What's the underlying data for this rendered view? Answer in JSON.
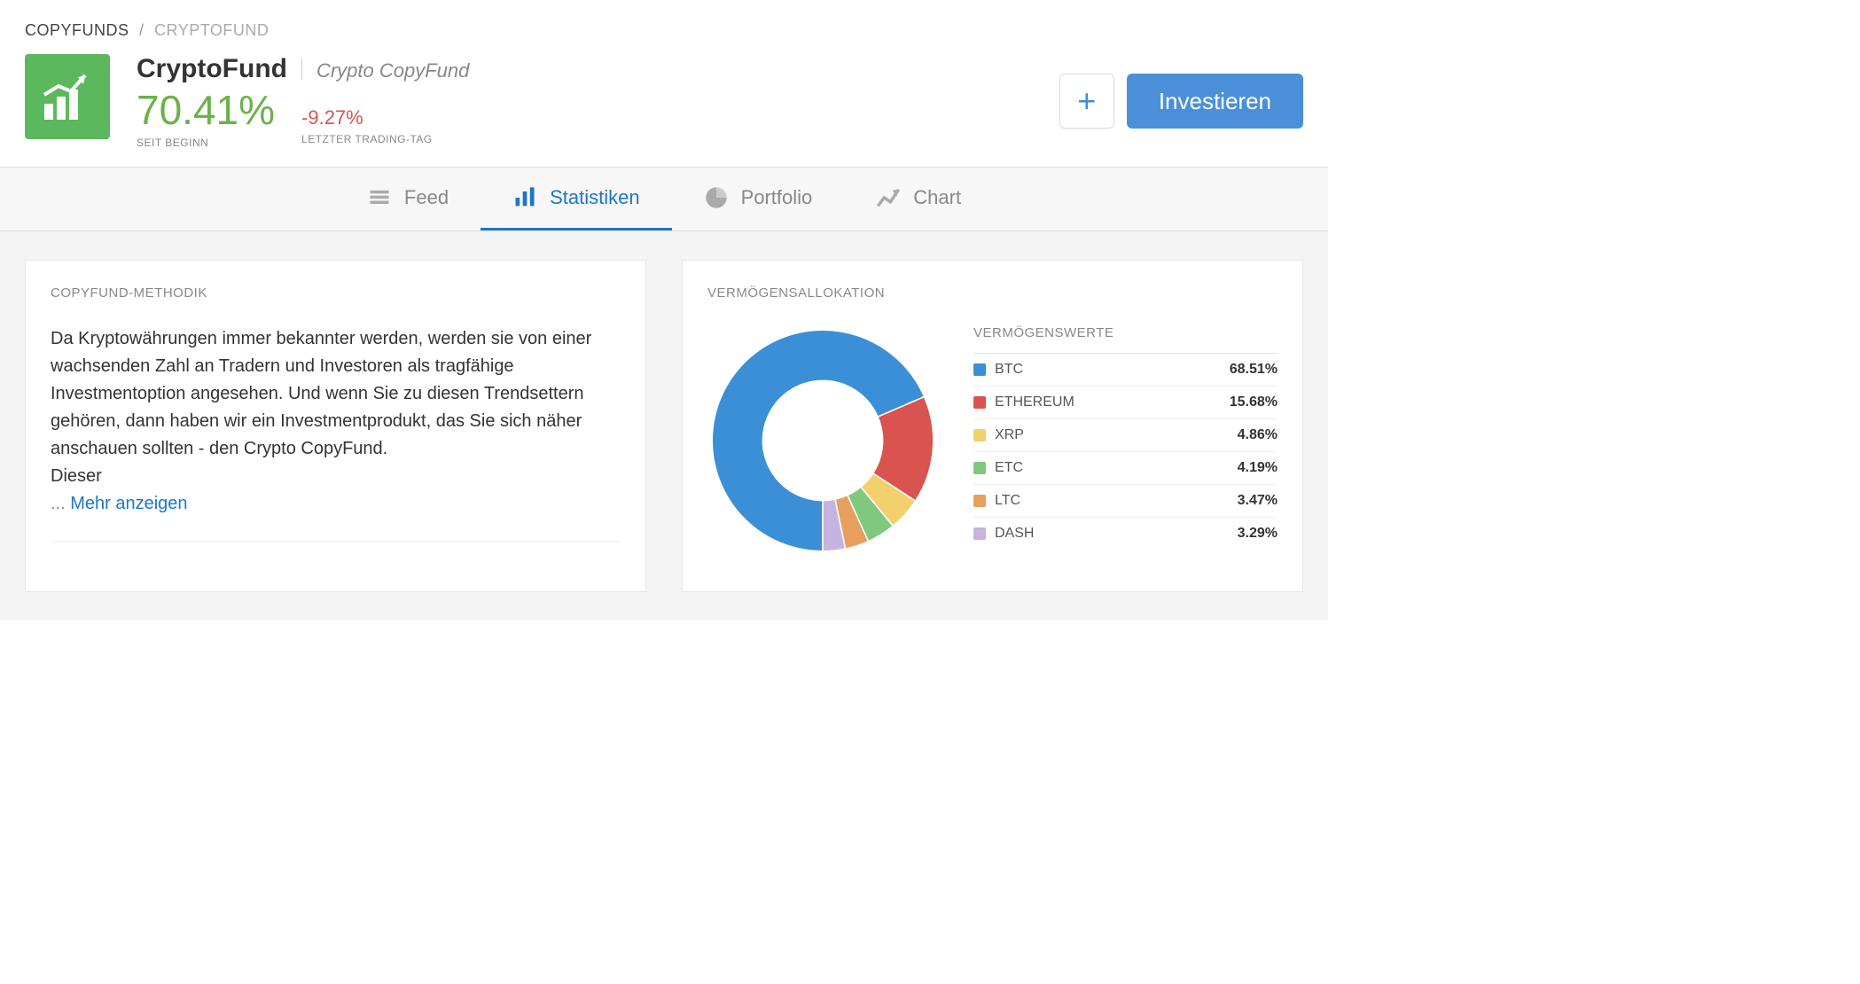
{
  "breadcrumb": {
    "root": "COPYFUNDS",
    "current": "CRYPTOFUND"
  },
  "fund": {
    "title": "CryptoFund",
    "subtitle": "Crypto CopyFund",
    "since_begin_value": "70.41%",
    "since_begin_label": "SEIT BEGINN",
    "last_day_value": "-9.27%",
    "last_day_label": "LETZTER TRADING-TAG"
  },
  "actions": {
    "invest": "Investieren"
  },
  "tabs": {
    "feed": "Feed",
    "stats": "Statistiken",
    "portfolio": "Portfolio",
    "chart": "Chart"
  },
  "methodology": {
    "title": "COPYFUND-METHODIK",
    "text": "Da Kryptowährungen immer bekannter werden, werden sie von einer wachsenden Zahl an Tradern und Investoren als tragfähige Investmentoption angesehen. Und wenn Sie zu diesen Trendsettern gehören, dann haben wir ein Investmentprodukt, das Sie sich näher anschauen sollten - den Crypto CopyFund.",
    "text2": "Dieser",
    "more": "Mehr anzeigen",
    "ellipsis": "... "
  },
  "allocation": {
    "title": "VERMÖGENSALLOKATION",
    "legend_title": "VERMÖGENSWERTE",
    "items": [
      {
        "name": "BTC",
        "value": "68.51%",
        "pct": 68.51,
        "color": "#3b8fd6"
      },
      {
        "name": "ETHEREUM",
        "value": "15.68%",
        "pct": 15.68,
        "color": "#d9534f"
      },
      {
        "name": "XRP",
        "value": "4.86%",
        "pct": 4.86,
        "color": "#f2d06b"
      },
      {
        "name": "ETC",
        "value": "4.19%",
        "pct": 4.19,
        "color": "#7fc97f"
      },
      {
        "name": "LTC",
        "value": "3.47%",
        "pct": 3.47,
        "color": "#e69f5c"
      },
      {
        "name": "DASH",
        "value": "3.29%",
        "pct": 3.29,
        "color": "#c6b3e0"
      }
    ]
  },
  "chart_data": {
    "type": "pie",
    "title": "Vermögensallokation",
    "categories": [
      "BTC",
      "ETHEREUM",
      "XRP",
      "ETC",
      "LTC",
      "DASH"
    ],
    "values": [
      68.51,
      15.68,
      4.86,
      4.19,
      3.47,
      3.29
    ],
    "colors": [
      "#3b8fd6",
      "#d9534f",
      "#f2d06b",
      "#7fc97f",
      "#e69f5c",
      "#c6b3e0"
    ]
  }
}
